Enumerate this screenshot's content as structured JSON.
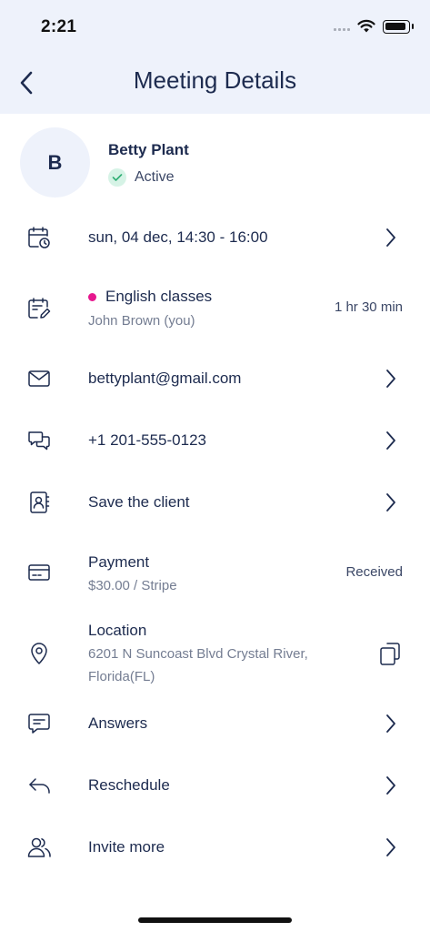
{
  "status_bar": {
    "time": "2:21"
  },
  "header": {
    "title": "Meeting Details",
    "back_icon": "chevron-left-icon"
  },
  "profile": {
    "initial": "B",
    "name": "Betty Plant",
    "status": "Active",
    "status_color": "#d6f3e6"
  },
  "rows": {
    "datetime": {
      "title": "sun, 04 dec, 14:30 - 16:00",
      "icon": "calendar-clock-icon"
    },
    "class": {
      "title": "English classes",
      "subtitle": "John Brown (you)",
      "duration": "1 hr 30 min",
      "dot_color": "#e6178e",
      "icon": "calendar-edit-icon"
    },
    "email": {
      "title": "bettyplant@gmail.com",
      "icon": "mail-icon"
    },
    "phone": {
      "title": "+1 201-555-0123",
      "icon": "chat-bubbles-icon"
    },
    "save": {
      "title": "Save the client",
      "icon": "contact-book-icon"
    },
    "payment": {
      "title": "Payment",
      "subtitle": "$30.00 / Stripe",
      "status": "Received",
      "icon": "credit-card-icon"
    },
    "location": {
      "title": "Location",
      "subtitle_line1": "6201 N Suncoast Blvd Crystal River,",
      "subtitle_line2": "Florida(FL)",
      "icon": "map-pin-icon",
      "action_icon": "copy-icon"
    },
    "answers": {
      "title": "Answers",
      "icon": "message-square-icon"
    },
    "reschedule": {
      "title": "Reschedule",
      "icon": "reply-arrow-icon"
    },
    "invite": {
      "title": "Invite more",
      "icon": "users-icon"
    }
  },
  "colors": {
    "header_bg": "#eef2fb",
    "text_primary": "#1d2b4f",
    "text_secondary": "#747d92",
    "accent_pink": "#e6178e"
  }
}
